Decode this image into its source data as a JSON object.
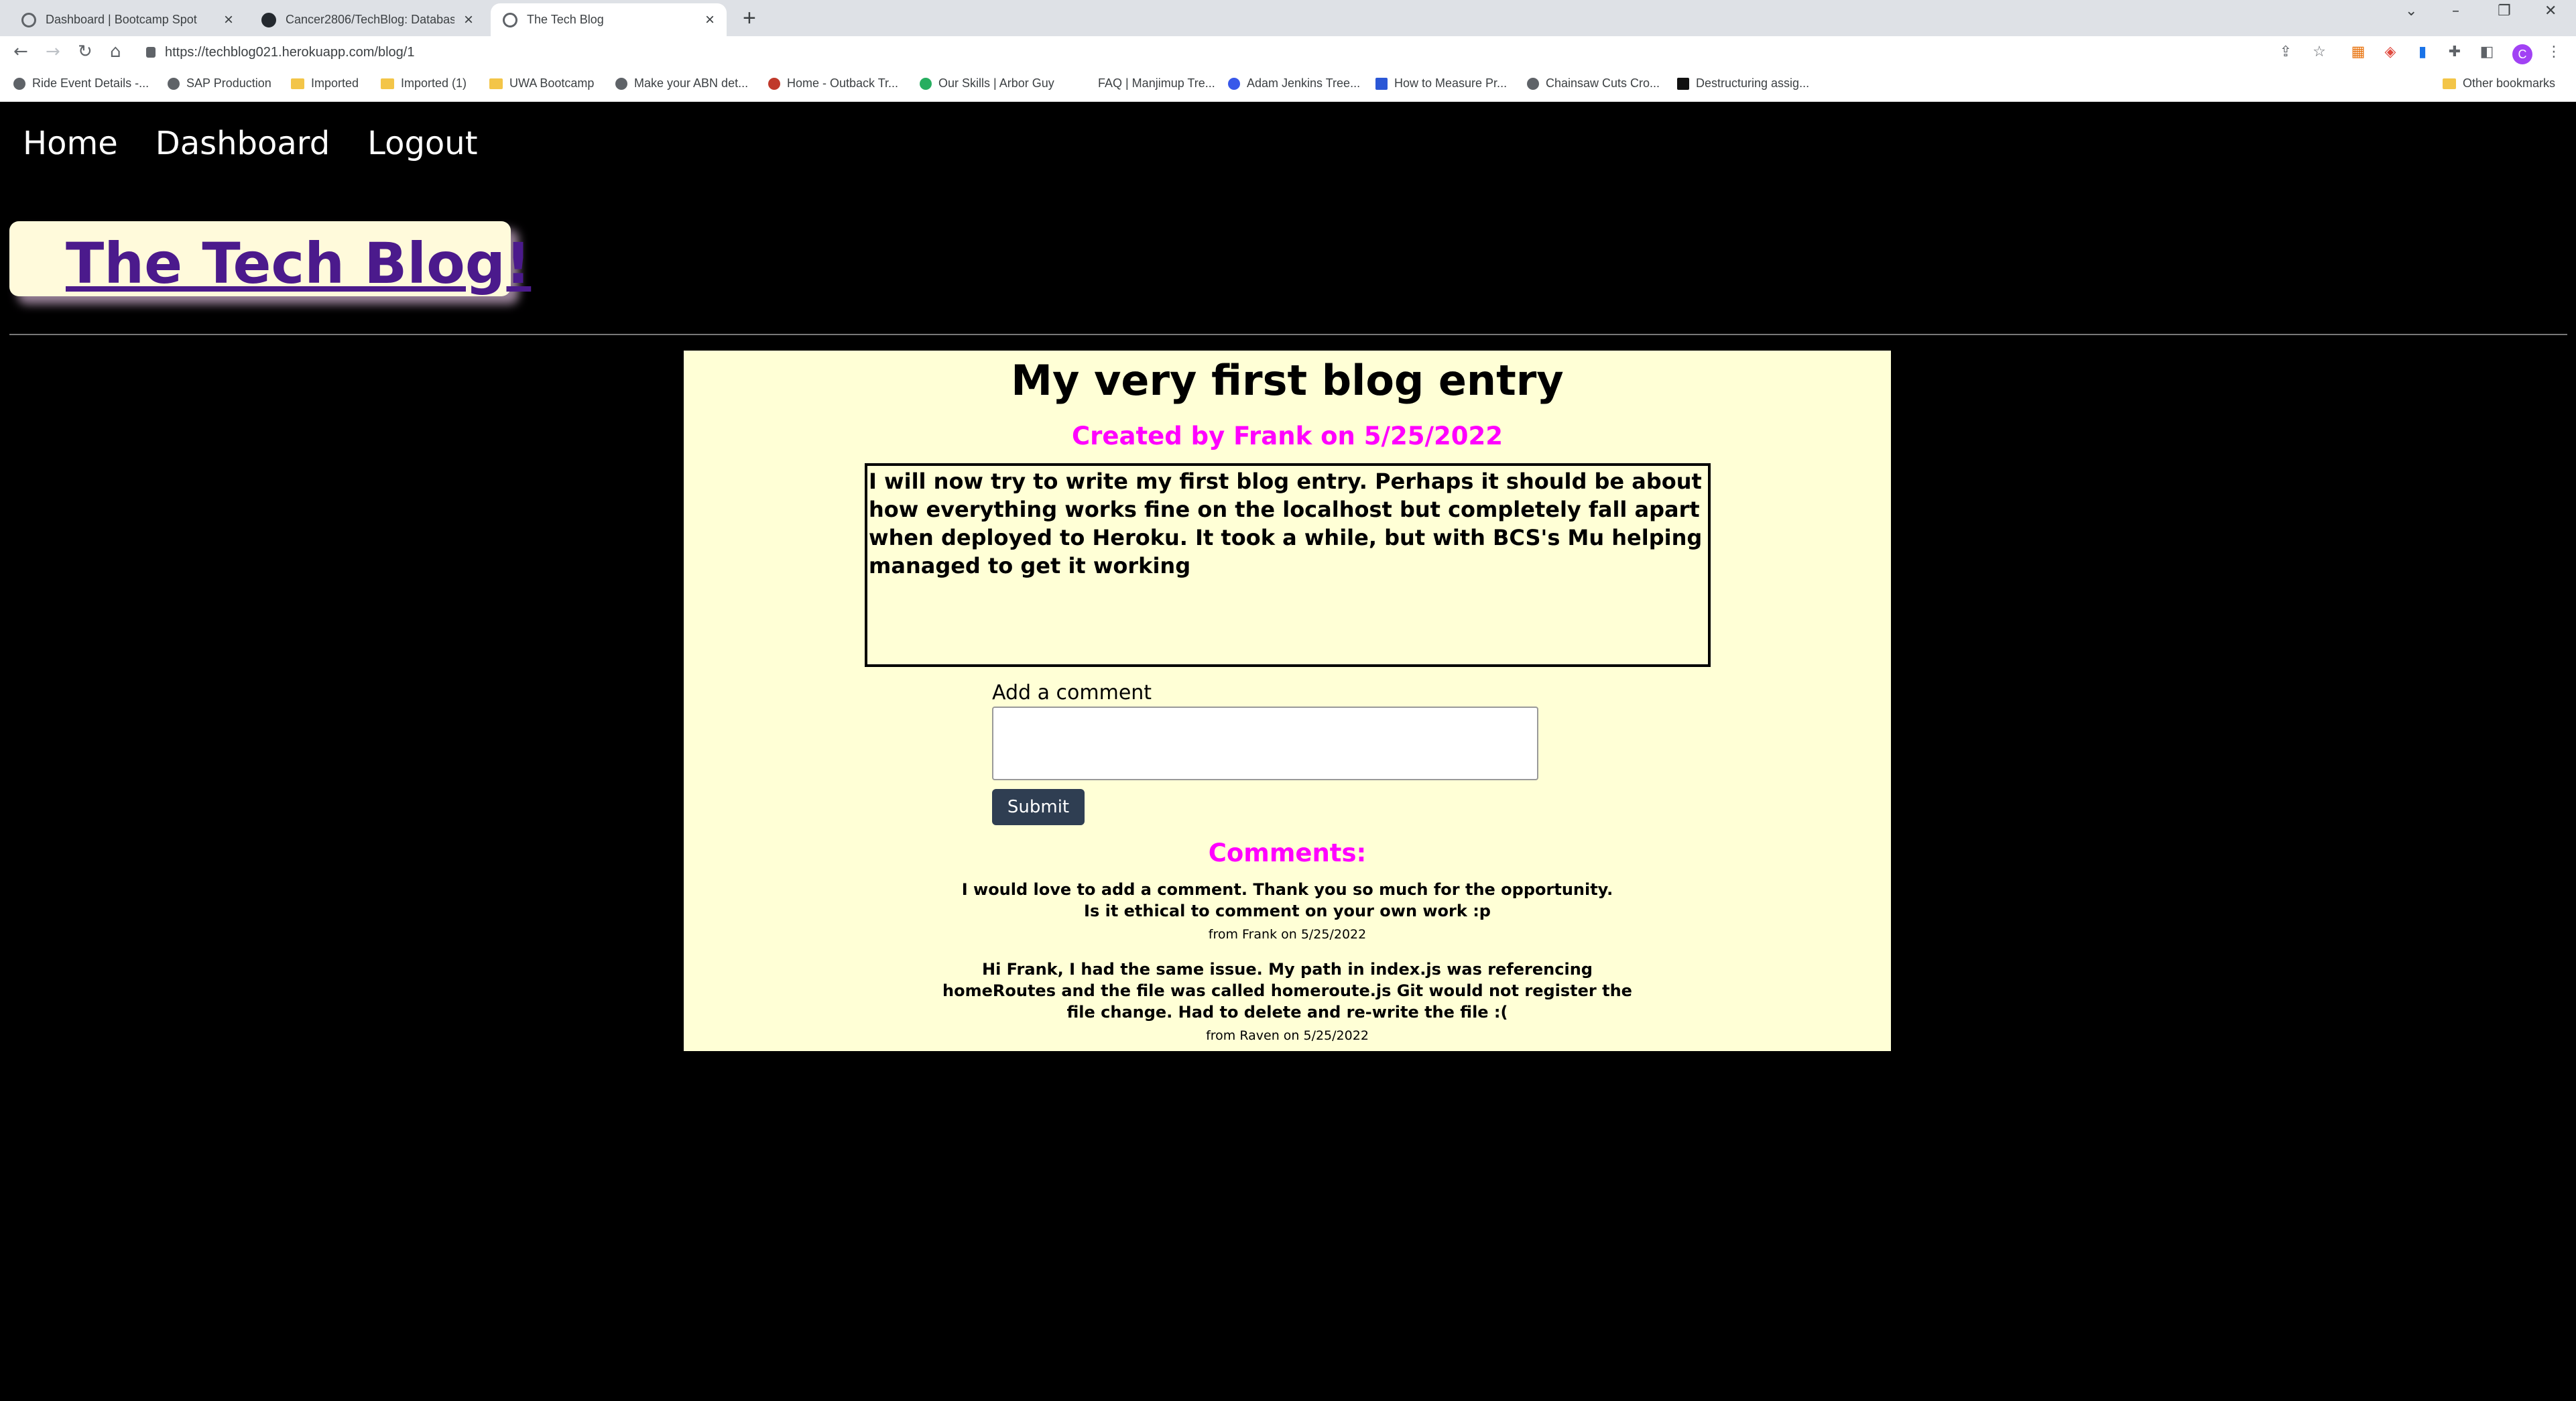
{
  "browser": {
    "tabs": [
      {
        "title": "Dashboard | Bootcamp Spot"
      },
      {
        "title": "Cancer2806/TechBlog: Database"
      },
      {
        "title": "The Tech Blog"
      }
    ],
    "url": "https://techblog021.herokuapp.com/blog/1",
    "avatar_letter": "C",
    "bookmarks": [
      "Ride Event Details -...",
      "SAP Production",
      "Imported",
      "Imported (1)",
      "UWA Bootcamp",
      "Make your ABN det...",
      "Home - Outback Tr...",
      "Our Skills | Arbor Guy",
      "FAQ | Manjimup Tre...",
      "Adam Jenkins Tree...",
      "How to Measure Pr...",
      "Chainsaw Cuts Cro...",
      "Destructuring assig..."
    ],
    "other_bookmarks": "Other bookmarks"
  },
  "nav": {
    "home": "Home",
    "dashboard": "Dashboard",
    "logout": "Logout"
  },
  "brand": {
    "title": "The Tech Blog!"
  },
  "post": {
    "title": "My very first blog entry",
    "meta": "Created by Frank on 5/25/2022",
    "body": "I will now try to write my first blog entry. Perhaps it should be about how everything works fine on the localhost but completely fall apart when deployed to Heroku. It took a while, but with BCS's Mu helping managed to get it working"
  },
  "comment_form": {
    "label": "Add a comment",
    "submit": "Submit"
  },
  "comments": {
    "heading": "Comments:",
    "items": [
      {
        "text": "I would love to add a comment. Thank you so much for the opportunity. Is it ethical to comment on your own work :p",
        "meta": "from Frank on 5/25/2022"
      },
      {
        "text": "Hi Frank, I had the same issue. My path in index.js was referencing homeRoutes and the file was called homeroute.js Git would not register the file change. Had to delete and re-write the file :(",
        "meta": "from Raven on 5/25/2022"
      }
    ]
  }
}
